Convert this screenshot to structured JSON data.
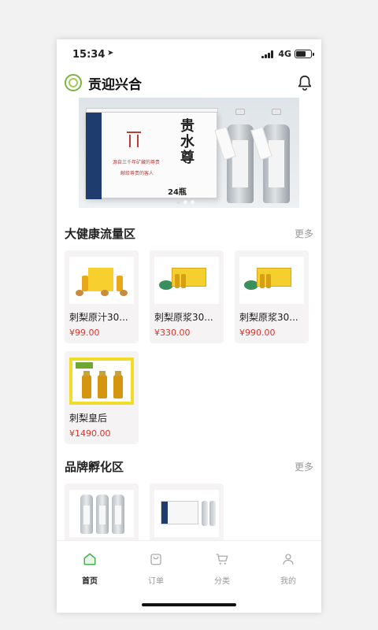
{
  "status": {
    "time": "15:34",
    "network": "4G"
  },
  "header": {
    "title": "贡迎兴合"
  },
  "banner": {
    "box_line1": "源自三千年矿藏的尊贵",
    "box_line2": "献给尊贵的客人",
    "product_title": "贵水尊",
    "box_count": "24瓶",
    "active_slide": 1,
    "slide_count": 3
  },
  "sections": [
    {
      "title": "大健康流量区",
      "more": "更多",
      "items": [
        {
          "name": "刺梨原汁30...",
          "price": "¥99.00"
        },
        {
          "name": "刺梨原浆30...",
          "price": "¥330.00"
        },
        {
          "name": "刺梨原浆30...",
          "price": "¥990.00"
        },
        {
          "name": "刺梨皇后",
          "price": "¥1490.00"
        }
      ]
    },
    {
      "title": "品牌孵化区",
      "more": "更多",
      "items": []
    }
  ],
  "tabbar": [
    {
      "label": "首页",
      "icon": "home-icon",
      "active": true
    },
    {
      "label": "订单",
      "icon": "bag-icon",
      "active": false
    },
    {
      "label": "分类",
      "icon": "cart-icon",
      "active": false
    },
    {
      "label": "我的",
      "icon": "person-icon",
      "active": false
    }
  ],
  "colors": {
    "price": "#d9352b",
    "active_tab": "#4caf50",
    "brand_green": "#7cb342"
  }
}
